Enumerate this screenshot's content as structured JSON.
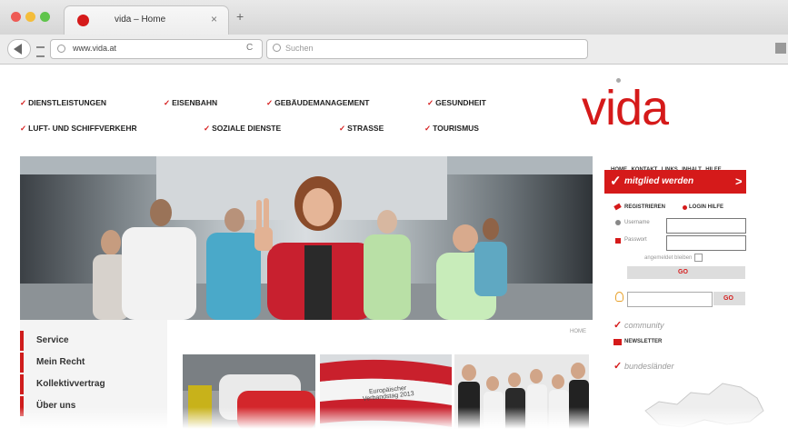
{
  "browser": {
    "tab_title": "vida – Home",
    "new_tab_symbol": "+",
    "tab_close": "×",
    "url": "www.vida.at",
    "search_placeholder": "Suchen",
    "reload_symbol": "C"
  },
  "site": {
    "logo": "vida",
    "categories_row1": [
      "DIENSTLEISTUNGEN",
      "EISENBAHN",
      "GEBÄUDEMANAGEMENT",
      "GESUNDHEIT"
    ],
    "categories_row2": [
      "LUFT- UND SCHIFFVERKEHR",
      "SOZIALE DIENSTE",
      "STRASSE",
      "TOURISMUS"
    ],
    "top_links": [
      "HOME",
      "KONTAKT",
      "LINKS",
      "INHALT",
      "HILFE"
    ],
    "member_cta": "mitglied werden",
    "member_arrow": ">",
    "register": "REGISTRIEREN",
    "login_help": "LOGIN HILFE",
    "username_label": "Username",
    "password_label": "Passwort",
    "remember_label": "angemeldet bleiben",
    "login_button": "GO",
    "search_button": "GO",
    "community": "community",
    "newsletter": "NEWSLETTER",
    "bundeslaender": "bundesländer",
    "breadcrumb_home": "HOME",
    "sidebar": [
      "Service",
      "Mein Recht",
      "Kollektivvertrag",
      "Über uns"
    ],
    "flag_banner_text": "Europäischer Verbandstag 2013"
  },
  "colors": {
    "brand_red": "#d51a1a",
    "chrome_bg": "#e4e4e4"
  }
}
